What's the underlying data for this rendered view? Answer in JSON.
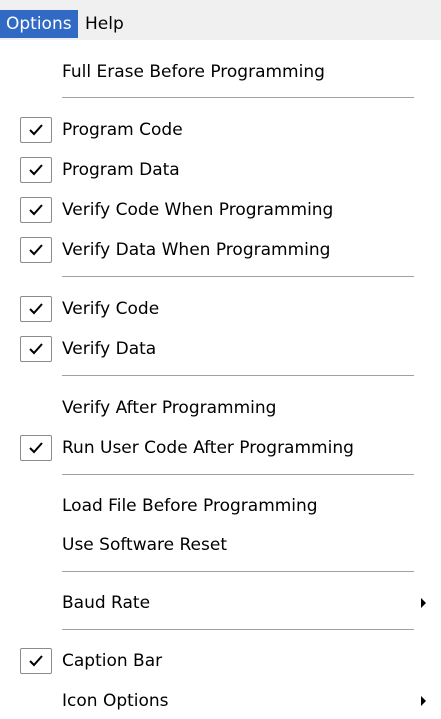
{
  "menubar": {
    "options_label": "Options",
    "help_label": "Help"
  },
  "menu": {
    "full_erase": {
      "label": "Full Erase Before Programming",
      "checked": false
    },
    "program_code": {
      "label": "Program Code",
      "checked": true
    },
    "program_data": {
      "label": "Program Data",
      "checked": true
    },
    "verify_code_when_programming": {
      "label": "Verify Code When Programming",
      "checked": true
    },
    "verify_data_when_programming": {
      "label": "Verify Data When Programming",
      "checked": true
    },
    "verify_code": {
      "label": "Verify Code",
      "checked": true
    },
    "verify_data": {
      "label": "Verify Data",
      "checked": true
    },
    "verify_after_programming": {
      "label": "Verify After Programming",
      "checked": false
    },
    "run_user_code": {
      "label": "Run User Code After Programming",
      "checked": true
    },
    "load_file": {
      "label": "Load File Before Programming",
      "checked": false
    },
    "use_software_reset": {
      "label": "Use Software Reset",
      "checked": false
    },
    "baud_rate": {
      "label": "Baud Rate",
      "has_submenu": true
    },
    "caption_bar": {
      "label": "Caption Bar",
      "checked": true
    },
    "icon_options": {
      "label": "Icon Options",
      "has_submenu": true
    }
  },
  "colors": {
    "menu_highlight": "#316ac5",
    "menubar_background": "#f0f0f0",
    "checkbox_border": "#8b8b8b"
  }
}
